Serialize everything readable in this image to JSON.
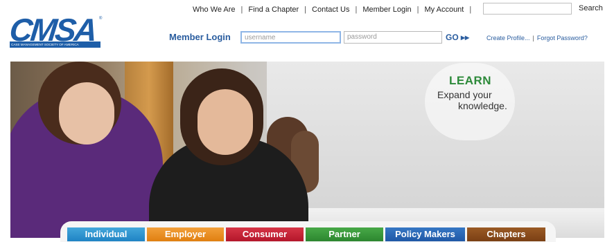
{
  "nav": {
    "items": [
      "Who We Are",
      "Find a Chapter",
      "Contact Us",
      "Member Login",
      "My Account"
    ],
    "search_button": "Search",
    "search_value": ""
  },
  "logo": {
    "word": "CMSA",
    "registered": "®",
    "tagline": "CASE MANAGEMENT SOCIETY OF AMERICA"
  },
  "login": {
    "label": "Member Login",
    "username_placeholder": "username",
    "password_placeholder": "password",
    "go_label": "GO ▸▸",
    "create_profile": "Create Profile...",
    "separator": "|",
    "forgot_password": "Forgot Password?"
  },
  "hero": {
    "headline": "LEARN",
    "subtext_line1": "Expand your",
    "subtext_line2": "knowledge."
  },
  "tabs": [
    "Individual",
    "Employer",
    "Consumer",
    "Partner",
    "Policy Makers",
    "Chapters"
  ],
  "colors": {
    "brand_blue": "#1e5ea8",
    "learn_green": "#2d8a3a",
    "tab_individual": "#1f83c4",
    "tab_employer": "#e07f10",
    "tab_consumer": "#b4162a",
    "tab_partner": "#2c862f",
    "tab_policy": "#1f58a6",
    "tab_chapters": "#7a3f14"
  }
}
